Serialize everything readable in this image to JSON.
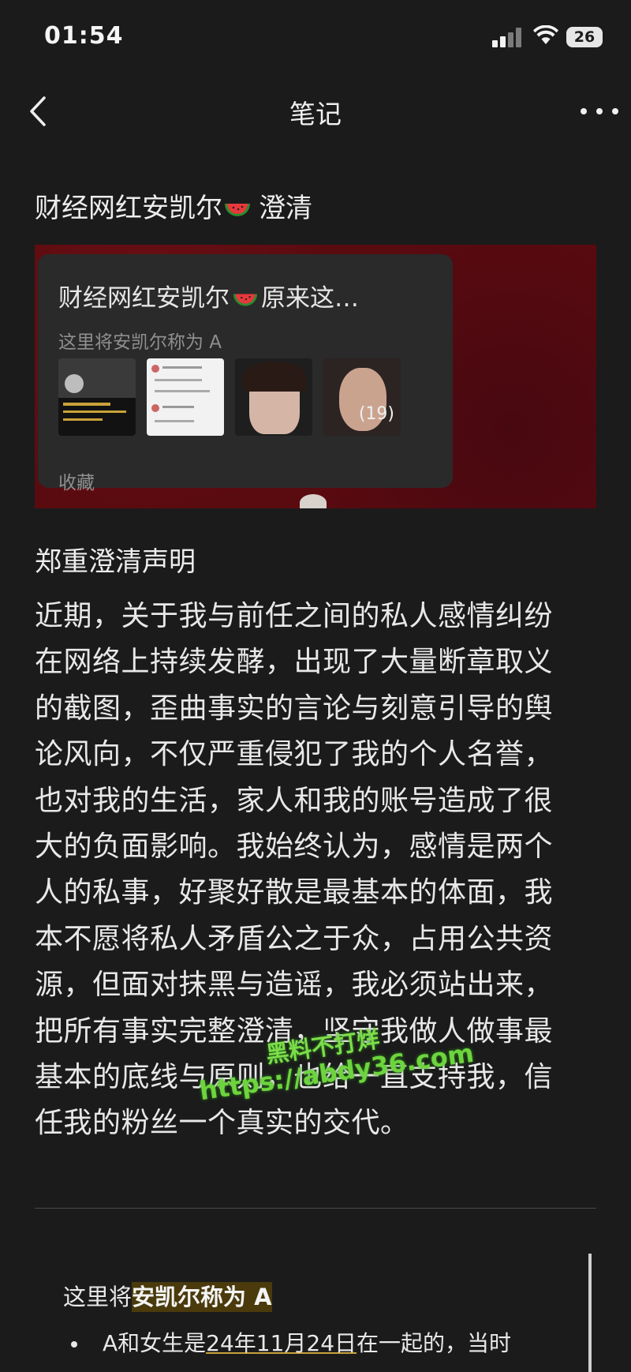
{
  "status_bar": {
    "time": "01:54",
    "battery": "26"
  },
  "nav": {
    "title": "笔记"
  },
  "note": {
    "title": "财经网红安凯尔",
    "title_suffix": "澄清"
  },
  "embed": {
    "card_title": "财经网红安凯尔",
    "card_title_suffix": "原来这…",
    "card_subtitle": "这里将安凯尔称为 A",
    "photo_count": "(19)",
    "footer": "收藏"
  },
  "section": {
    "heading": "郑重澄清声明"
  },
  "body_lines": [
    "近期，关于我与前任之间的私人感情纠纷",
    "在网络上持续发酵，出现了大量断章取义",
    "的截图，歪曲事实的言论与刻意引导的舆",
    "论风向，不仅严重侵犯了我的个人名誉，",
    "也对我的生活，家人和我的账号造成了很",
    "大的负面影响。我始终认为，感情是两个",
    "人的私事，好聚好散是最基本的体面，我",
    "本不愿将私人矛盾公之于众，占用公共资",
    "源，但面对抹黑与造谣，我必须站出来，",
    "把所有事实完整澄清，坚守我做人做事最",
    "基本的底线与原则，也给一直支持我，信",
    "任我的粉丝一个真实的交代。"
  ],
  "watermark": {
    "line1": "黑料不打烊",
    "line2": "https://abdy36.com"
  },
  "quote": {
    "prefix": "这里将",
    "highlight": "安凯尔称为 A",
    "bullet_start": "A和女生是",
    "bullet_date": "24年11月24日",
    "bullet_end": "在一起的，当时"
  }
}
